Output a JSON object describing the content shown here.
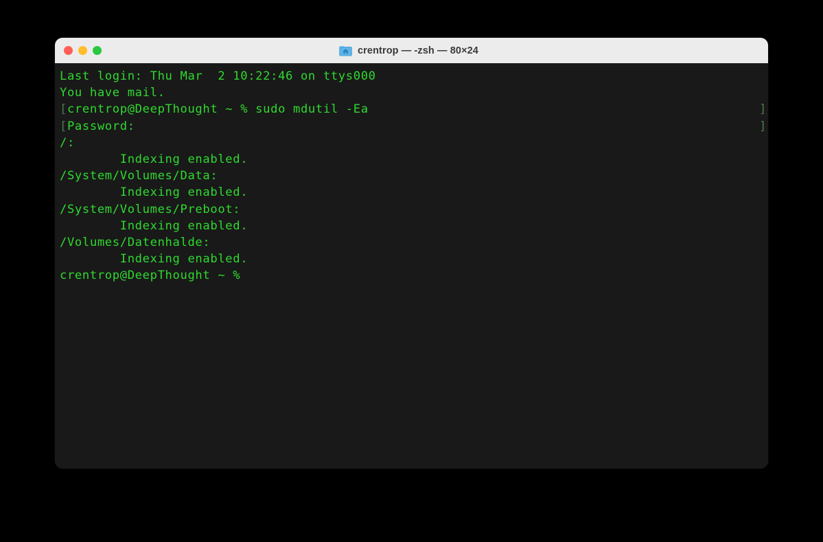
{
  "window": {
    "title": "crentrop — -zsh — 80×24",
    "icon": "home-folder-icon",
    "controls": {
      "close_label": "close",
      "minimize_label": "minimize",
      "zoom_label": "zoom"
    },
    "size_label": "80×24",
    "shell": "-zsh",
    "user": "crentrop"
  },
  "colors": {
    "titlebar_bg": "#ececec",
    "titlebar_text": "#3a3a3a",
    "terminal_bg": "#191919",
    "terminal_text": "#2fd92f",
    "prompt_mark": "#4c7a4c",
    "traffic_close": "#ff5f57",
    "traffic_minimize": "#ffbd2e",
    "traffic_zoom": "#28c840",
    "page_bg": "#000000"
  },
  "terminal": {
    "cols": 80,
    "rows": 24,
    "lines": [
      {
        "mark_start": "",
        "text": "Last login: Thu Mar  2 10:22:46 on ttys000",
        "mark_end": ""
      },
      {
        "mark_start": "",
        "text": "You have mail.",
        "mark_end": ""
      },
      {
        "mark_start": "[",
        "text": "crentrop@DeepThought ~ % sudo mdutil -Ea",
        "mark_end": "]"
      },
      {
        "mark_start": "[",
        "text": "Password:",
        "mark_end": "]"
      },
      {
        "mark_start": "",
        "text": "/:",
        "mark_end": ""
      },
      {
        "mark_start": "",
        "text": "        Indexing enabled.",
        "mark_end": ""
      },
      {
        "mark_start": "",
        "text": "/System/Volumes/Data:",
        "mark_end": ""
      },
      {
        "mark_start": "",
        "text": "        Indexing enabled.",
        "mark_end": ""
      },
      {
        "mark_start": "",
        "text": "/System/Volumes/Preboot:",
        "mark_end": ""
      },
      {
        "mark_start": "",
        "text": "        Indexing enabled.",
        "mark_end": ""
      },
      {
        "mark_start": "",
        "text": "/Volumes/Datenhalde:",
        "mark_end": ""
      },
      {
        "mark_start": "",
        "text": "        Indexing enabled.",
        "mark_end": ""
      },
      {
        "mark_start": "",
        "text": "crentrop@DeepThought ~ %",
        "mark_end": ""
      }
    ]
  }
}
